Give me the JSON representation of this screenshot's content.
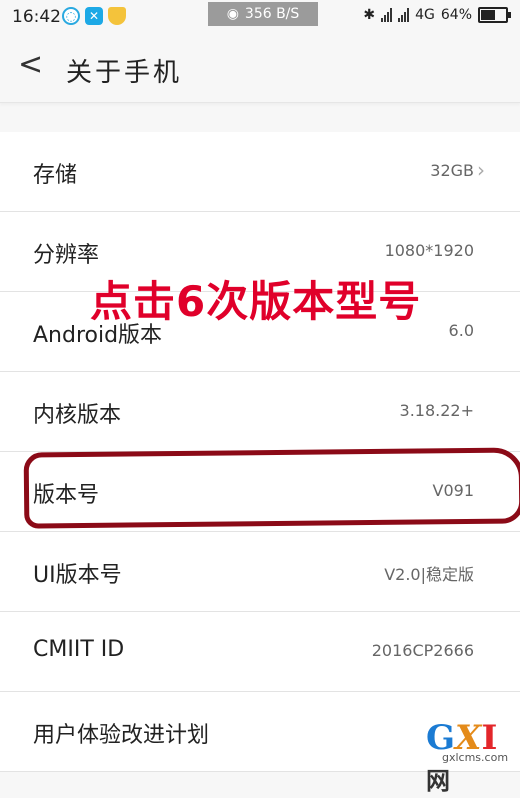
{
  "status_bar": {
    "time": "16:42",
    "network_speed": "356 B/S",
    "network": "4G",
    "battery": "64%",
    "battery_level": 0.64
  },
  "header": {
    "back_glyph": "<",
    "title": "关于手机"
  },
  "rows": [
    {
      "label": "存储",
      "value": "32GB",
      "has_chevron": true
    },
    {
      "label": "分辨率",
      "value": "1080*1920"
    },
    {
      "label": "Android版本",
      "value": "6.0"
    },
    {
      "label": "内核版本",
      "value": "3.18.22+"
    },
    {
      "label": "版本号",
      "value": "V091"
    },
    {
      "label": "UI版本号",
      "value": "V2.0|稳定版"
    },
    {
      "label": "CMIIT ID",
      "value": "2016CP2666"
    },
    {
      "label": "用户体验改进计划",
      "value": ""
    }
  ],
  "annotation": {
    "text": "点击6次版本型号",
    "color": "#e0002a",
    "circle_color": "#8b0a17"
  },
  "watermark": {
    "logo": "GXI网",
    "domain": "gxlcms.com"
  }
}
